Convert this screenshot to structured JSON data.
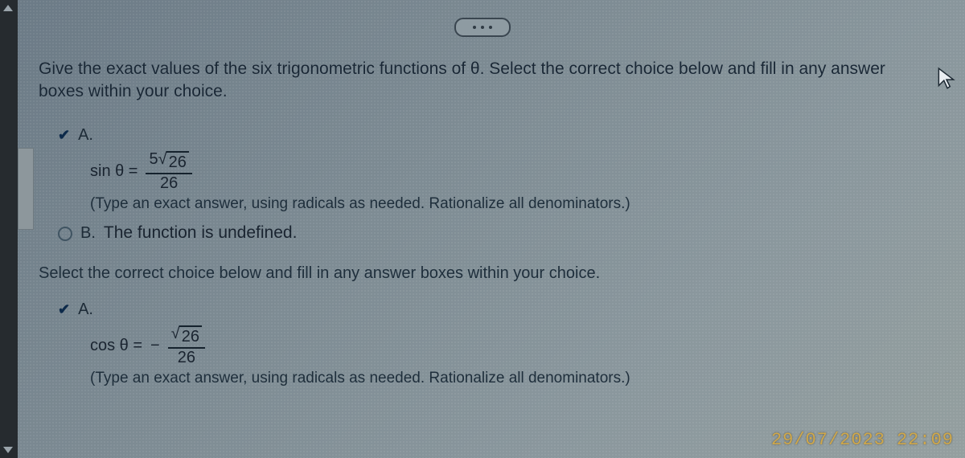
{
  "prompt_line1": "Give the exact values of the six trigonometric functions of θ. Select the correct choice below and fill in any answer",
  "prompt_line2": "boxes within your choice.",
  "q1": {
    "choiceA_letter": "A.",
    "lhs": "sin θ =",
    "num_coef": "5",
    "num_radicand": "26",
    "den": "26",
    "hint": "(Type an exact answer, using radicals as needed. Rationalize all denominators.)",
    "choiceB_letter": "B.",
    "choiceB_text": "The function is undefined."
  },
  "second_prompt": "Select the correct choice below and fill in any answer boxes within your choice.",
  "q2": {
    "choiceA_letter": "A.",
    "lhs": "cos θ =",
    "neg": "−",
    "num_radicand": "26",
    "den": "26",
    "hint": "(Type an exact answer, using radicals as needed. Rationalize all denominators.)"
  },
  "timestamp": {
    "date": "29/07/2023",
    "time": "22:09"
  }
}
